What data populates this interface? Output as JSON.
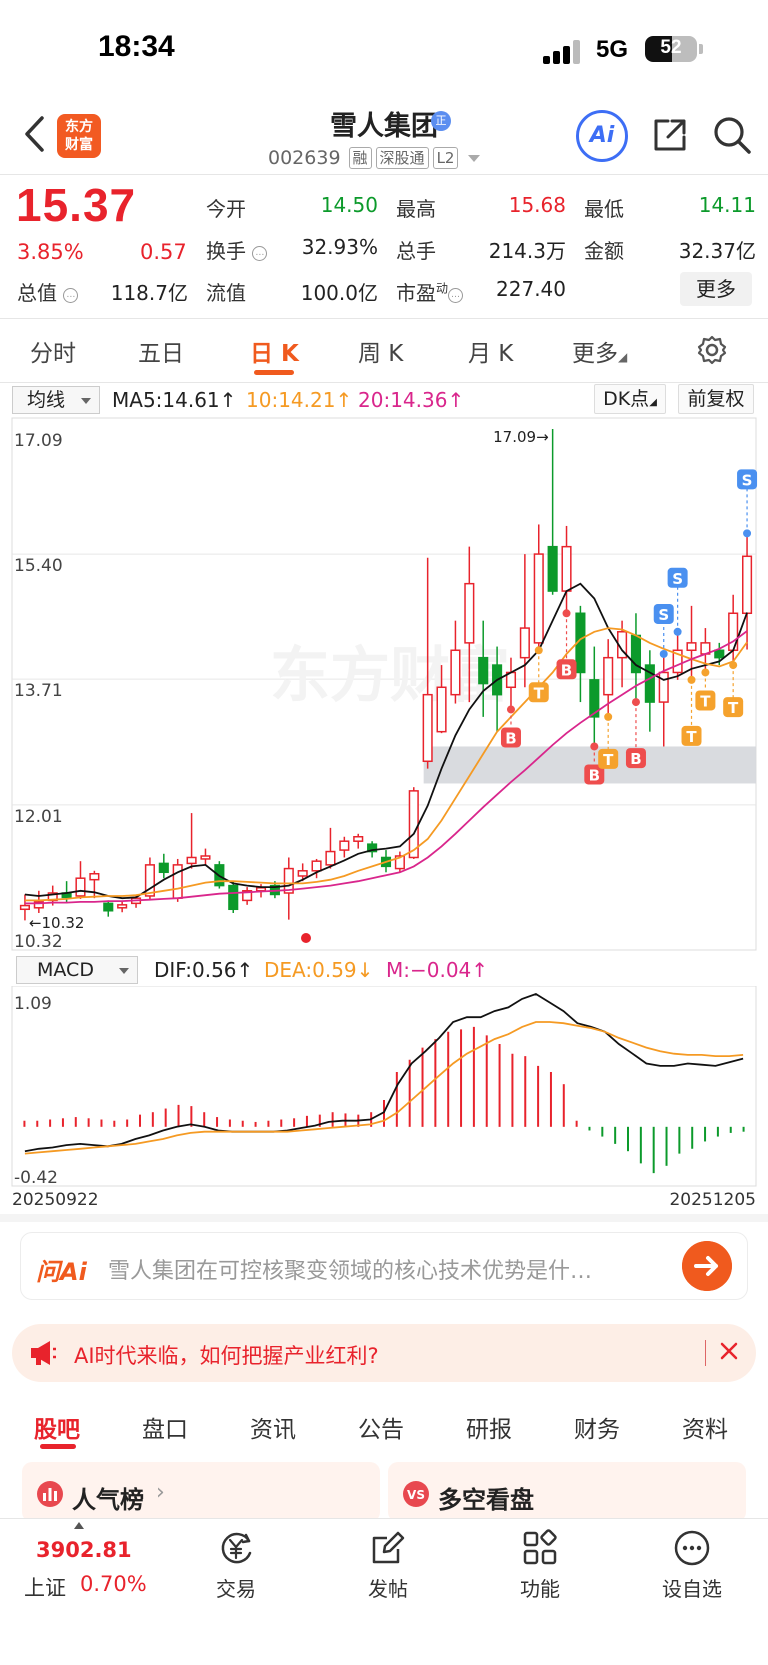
{
  "status_bar": {
    "time": "18:34",
    "network": "5G",
    "battery": "52",
    "battery_level": 0.52
  },
  "header": {
    "logo_line1": "东方",
    "logo_line2": "财富",
    "stock_name": "雪人集团",
    "name_badge": "正",
    "stock_code": "002639",
    "tags": [
      "融",
      "深股通",
      "L2"
    ],
    "ai_label": "Ai"
  },
  "quote": {
    "price": "15.37",
    "change_pct": "3.85%",
    "change": "0.57",
    "open_label": "今开",
    "open": "14.50",
    "high_label": "最高",
    "high": "15.68",
    "low_label": "最低",
    "low": "14.11",
    "turnover_label": "换手",
    "turnover": "32.93%",
    "volume_label": "总手",
    "volume": "214.3万",
    "amount_label": "金额",
    "amount": "32.37亿",
    "mktcap_label": "总值",
    "mktcap": "118.7亿",
    "float_label": "流值",
    "float_cap": "100.0亿",
    "pe_label": "市盈",
    "pe_sup": "动",
    "pe": "227.40",
    "more": "更多"
  },
  "period_tabs": [
    "分时",
    "五日",
    "日 K",
    "周 K",
    "月 K",
    "更多"
  ],
  "active_period": "日 K",
  "indicator_bar": {
    "select": "均线",
    "ma5": "MA5:14.61↑",
    "ma10": "10:14.21↑",
    "ma20": "20:14.36↑",
    "dk": "DK点",
    "adjust": "前复权",
    "colors": {
      "ma5": "#111111",
      "ma10": "#f59a23",
      "ma20": "#d9268c"
    }
  },
  "macd_bar": {
    "select": "MACD",
    "dif": "DIF:0.56↑",
    "dea": "DEA:0.59↓",
    "m": "M:−0.04↑"
  },
  "chart_data": [
    {
      "type": "candlestick",
      "title": "",
      "ylim": [
        10.32,
        17.09
      ],
      "y_ticks": [
        "17.09",
        "15.40",
        "13.71",
        "12.01",
        "10.32"
      ],
      "max_label": "17.09→",
      "min_label": "←10.32",
      "watermark": "东方财富",
      "support_zone": [
        12.3,
        12.8
      ],
      "candles": [
        [
          10.6,
          10.8,
          10.65,
          10.45
        ],
        [
          10.62,
          10.85,
          10.7,
          10.55
        ],
        [
          10.72,
          10.92,
          10.82,
          10.65
        ],
        [
          10.82,
          10.98,
          10.76,
          10.68
        ],
        [
          10.78,
          11.25,
          11.02,
          10.74
        ],
        [
          11.0,
          11.12,
          11.08,
          10.75
        ],
        [
          10.68,
          10.72,
          10.58,
          10.5
        ],
        [
          10.62,
          10.7,
          10.66,
          10.56
        ],
        [
          10.68,
          10.8,
          10.75,
          10.62
        ],
        [
          10.78,
          11.3,
          11.2,
          10.72
        ],
        [
          11.22,
          11.35,
          11.1,
          11.02
        ],
        [
          10.75,
          11.28,
          11.2,
          10.7
        ],
        [
          11.22,
          11.9,
          11.3,
          11.15
        ],
        [
          11.28,
          11.42,
          11.32,
          11.2
        ],
        [
          11.2,
          11.25,
          10.92,
          10.88
        ],
        [
          10.92,
          10.98,
          10.6,
          10.55
        ],
        [
          10.72,
          10.9,
          10.85,
          10.66
        ],
        [
          10.85,
          10.94,
          10.89,
          10.76
        ],
        [
          10.92,
          10.98,
          10.8,
          10.75
        ],
        [
          10.82,
          11.3,
          11.15,
          10.46
        ],
        [
          11.05,
          11.22,
          11.12,
          10.98
        ],
        [
          11.12,
          11.28,
          11.25,
          11.02
        ],
        [
          11.2,
          11.7,
          11.38,
          11.15
        ],
        [
          11.4,
          11.58,
          11.52,
          11.3
        ],
        [
          11.52,
          11.62,
          11.58,
          11.42
        ],
        [
          11.48,
          11.52,
          11.38,
          11.3
        ],
        [
          11.3,
          11.4,
          11.18,
          11.1
        ],
        [
          11.15,
          11.38,
          11.32,
          11.1
        ],
        [
          11.3,
          12.25,
          12.2,
          11.28
        ],
        [
          12.6,
          15.35,
          13.5,
          12.5
        ],
        [
          13.0,
          13.9,
          13.6,
          12.98
        ],
        [
          13.5,
          14.5,
          14.1,
          13.38
        ],
        [
          14.2,
          15.5,
          15.0,
          13.4
        ],
        [
          14.0,
          14.5,
          13.65,
          13.2
        ],
        [
          13.9,
          14.15,
          13.5,
          13.0
        ],
        [
          13.6,
          14.0,
          13.8,
          13.3
        ],
        [
          14.0,
          15.4,
          14.4,
          13.6
        ],
        [
          14.2,
          15.8,
          15.4,
          14.1
        ],
        [
          15.5,
          17.09,
          14.9,
          14.85
        ],
        [
          14.9,
          15.78,
          15.5,
          14.6
        ],
        [
          14.6,
          14.7,
          13.8,
          13.4
        ],
        [
          13.7,
          14.15,
          13.2,
          12.8
        ],
        [
          13.5,
          14.25,
          14.0,
          13.2
        ],
        [
          14.0,
          14.5,
          14.35,
          13.6
        ],
        [
          14.3,
          14.6,
          13.8,
          13.4
        ],
        [
          13.9,
          14.1,
          13.4,
          13.0
        ],
        [
          13.4,
          14.05,
          13.8,
          12.8
        ],
        [
          13.8,
          14.35,
          14.1,
          13.7
        ],
        [
          14.1,
          14.7,
          14.2,
          13.7
        ],
        [
          14.05,
          14.4,
          14.2,
          13.8
        ],
        [
          14.1,
          14.2,
          14.0,
          13.9
        ],
        [
          14.1,
          14.85,
          14.6,
          13.9
        ],
        [
          14.6,
          15.68,
          15.37,
          14.11
        ]
      ],
      "series": [
        {
          "name": "MA5",
          "values": [
            10.8,
            10.78,
            10.8,
            10.82,
            10.85,
            10.83,
            10.78,
            10.75,
            10.76,
            10.88,
            11.0,
            11.1,
            11.18,
            11.2,
            11.05,
            10.95,
            10.92,
            10.9,
            10.9,
            10.92,
            11.0,
            11.1,
            11.18,
            11.26,
            11.35,
            11.4,
            11.42,
            11.45,
            11.62,
            12.0,
            12.5,
            12.95,
            13.3,
            13.55,
            13.7,
            13.8,
            13.9,
            14.1,
            14.5,
            14.9,
            15.0,
            14.8,
            14.4,
            14.1,
            13.9,
            13.8,
            13.7,
            13.75,
            13.85,
            13.9,
            13.95,
            14.1,
            14.61
          ]
        },
        {
          "name": "10",
          "values": [
            10.72,
            10.72,
            10.73,
            10.74,
            10.76,
            10.77,
            10.78,
            10.78,
            10.79,
            10.82,
            10.85,
            10.88,
            10.92,
            10.96,
            10.98,
            10.98,
            10.97,
            10.96,
            10.95,
            10.95,
            10.95,
            10.97,
            11.0,
            11.05,
            11.12,
            11.18,
            11.24,
            11.3,
            11.4,
            11.55,
            11.8,
            12.1,
            12.4,
            12.7,
            13.0,
            13.2,
            13.4,
            13.6,
            13.8,
            14.05,
            14.25,
            14.35,
            14.4,
            14.38,
            14.3,
            14.2,
            14.12,
            14.05,
            13.98,
            13.92,
            13.88,
            13.95,
            14.21
          ]
        },
        {
          "name": "20",
          "values": [
            10.68,
            10.68,
            10.69,
            10.69,
            10.7,
            10.7,
            10.71,
            10.71,
            10.72,
            10.73,
            10.74,
            10.75,
            10.77,
            10.79,
            10.81,
            10.82,
            10.83,
            10.84,
            10.85,
            10.86,
            10.88,
            10.9,
            10.92,
            10.95,
            10.98,
            11.02,
            11.06,
            11.1,
            11.18,
            11.3,
            11.45,
            11.62,
            11.8,
            11.98,
            12.15,
            12.32,
            12.48,
            12.65,
            12.82,
            12.98,
            13.12,
            13.25,
            13.38,
            13.5,
            13.62,
            13.72,
            13.82,
            13.9,
            13.98,
            14.05,
            14.12,
            14.22,
            14.36
          ]
        }
      ],
      "signals": [
        {
          "label": "B",
          "index": 35
        },
        {
          "label": "T",
          "index": 37
        },
        {
          "label": "B",
          "index": 39
        },
        {
          "label": "B",
          "index": 41
        },
        {
          "label": "T",
          "index": 42
        },
        {
          "label": "B",
          "index": 44
        },
        {
          "label": "S",
          "index": 46
        },
        {
          "label": "S",
          "index": 47
        },
        {
          "label": "T",
          "index": 48
        },
        {
          "label": "T",
          "index": 49
        },
        {
          "label": "T",
          "index": 51
        },
        {
          "label": "S",
          "index": 52
        }
      ]
    },
    {
      "type": "bar",
      "title": "MACD",
      "ylim": [
        -0.42,
        1.09
      ],
      "y_ticks": [
        "1.09",
        "-0.42"
      ],
      "x_labels": [
        "20250922",
        "20251205"
      ],
      "hist": [
        0.05,
        0.05,
        0.06,
        0.07,
        0.08,
        0.07,
        0.06,
        0.05,
        0.06,
        0.1,
        0.12,
        0.15,
        0.18,
        0.17,
        0.12,
        0.08,
        0.06,
        0.05,
        0.04,
        0.05,
        0.06,
        0.07,
        0.09,
        0.1,
        0.12,
        0.11,
        0.1,
        0.12,
        0.22,
        0.45,
        0.55,
        0.65,
        0.72,
        0.78,
        0.8,
        0.82,
        0.75,
        0.68,
        0.6,
        0.58,
        0.5,
        0.45,
        0.35,
        0.05,
        -0.03,
        -0.08,
        -0.14,
        -0.2,
        -0.3,
        -0.38,
        -0.32,
        -0.22,
        -0.18,
        -0.12,
        -0.08,
        -0.05,
        -0.04
      ],
      "series": [
        {
          "name": "DIF",
          "values": [
            -0.2,
            -0.18,
            -0.17,
            -0.15,
            -0.14,
            -0.15,
            -0.16,
            -0.14,
            -0.1,
            -0.07,
            -0.03,
            0.0,
            0.02,
            0.0,
            -0.03,
            -0.04,
            -0.04,
            -0.04,
            -0.04,
            -0.03,
            -0.01,
            0.01,
            0.04,
            0.05,
            0.05,
            0.06,
            0.12,
            0.35,
            0.52,
            0.62,
            0.73,
            0.86,
            0.9,
            0.9,
            0.95,
            0.98,
            1.05,
            1.09,
            1.02,
            0.95,
            0.85,
            0.82,
            0.78,
            0.68,
            0.6,
            0.52,
            0.5,
            0.5,
            0.52,
            0.51,
            0.5,
            0.53,
            0.56
          ]
        },
        {
          "name": "DEA",
          "values": [
            -0.22,
            -0.21,
            -0.2,
            -0.19,
            -0.18,
            -0.17,
            -0.16,
            -0.15,
            -0.14,
            -0.12,
            -0.1,
            -0.07,
            -0.05,
            -0.04,
            -0.04,
            -0.04,
            -0.04,
            -0.04,
            -0.04,
            -0.04,
            -0.03,
            -0.02,
            -0.01,
            0.0,
            0.01,
            0.02,
            0.05,
            0.12,
            0.22,
            0.32,
            0.42,
            0.52,
            0.6,
            0.66,
            0.72,
            0.76,
            0.82,
            0.86,
            0.86,
            0.85,
            0.83,
            0.81,
            0.78,
            0.73,
            0.69,
            0.65,
            0.62,
            0.6,
            0.59,
            0.59,
            0.58,
            0.58,
            0.59
          ]
        }
      ]
    }
  ],
  "ask_ai": {
    "logo": "问Ai",
    "placeholder": "雪人集团在可控核聚变领域的核心技术优势是什…"
  },
  "banner": {
    "text": "AI时代来临，如何把握产业红利?"
  },
  "bottom_tabs": [
    "股吧",
    "盘口",
    "资讯",
    "公告",
    "研报",
    "财务",
    "资料"
  ],
  "cards": {
    "hot": "人气榜",
    "vs": "多空看盘"
  },
  "bottom_nav": {
    "index_value": "3902.81",
    "index_name": "上证",
    "index_pct": "0.70%",
    "items": [
      "交易",
      "发帖",
      "功能",
      "设自选"
    ]
  }
}
